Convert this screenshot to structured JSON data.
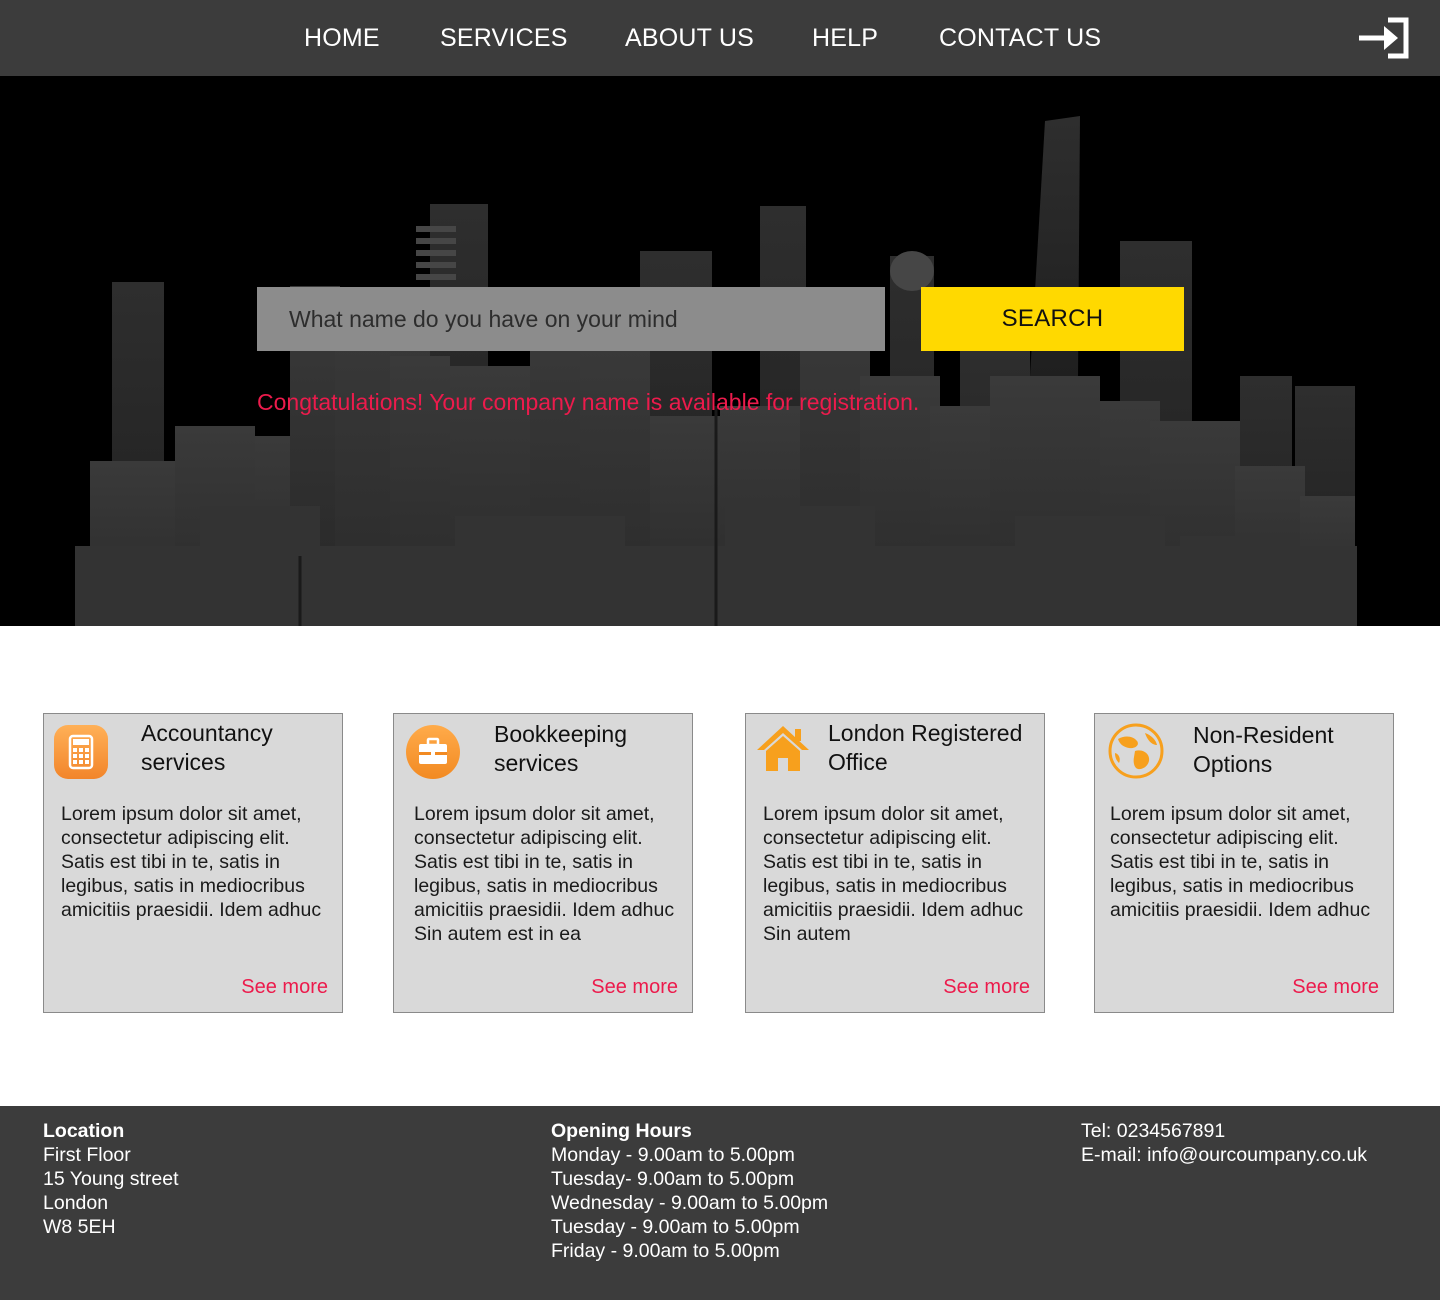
{
  "nav": {
    "items": [
      {
        "label": "HOME"
      },
      {
        "label": "SERVICES"
      },
      {
        "label": "ABOUT US"
      },
      {
        "label": "HELP"
      },
      {
        "label": "CONTACT US"
      }
    ],
    "login_icon": "sign-in-arrow-icon"
  },
  "hero": {
    "search_placeholder": "What name do you have on your mind",
    "search_button": "SEARCH",
    "message": "Congtatulations! Your company name is available for registration."
  },
  "services": [
    {
      "icon": "calculator-icon",
      "title_line1": "Accountancy",
      "title_line2": "services",
      "body": "Lorem ipsum dolor sit amet, consectetur adipiscing elit. Satis est tibi in te, satis in legibus, satis in mediocribus amicitiis praesidii. Idem adhuc",
      "link": "See more"
    },
    {
      "icon": "briefcase-icon",
      "title_line1": "Bookkeeping",
      "title_line2": "services",
      "body": "Lorem ipsum dolor sit amet, consectetur adipiscing elit. Satis est tibi in te, satis in legibus, satis in mediocribus amicitiis praesidii. Idem adhuc Sin autem est in ea",
      "link": "See more"
    },
    {
      "icon": "house-icon",
      "title_line1": "London Registered",
      "title_line2": "Office",
      "body": "Lorem ipsum dolor sit amet, consectetur adipiscing elit. Satis est tibi in te, satis in legibus, satis in mediocribus amicitiis praesidii. Idem adhuc Sin autem",
      "link": "See more"
    },
    {
      "icon": "globe-icon",
      "title_line1": "Non-Resident",
      "title_line2": "Options",
      "body": "Lorem ipsum dolor sit amet, consectetur adipiscing elit. Satis est tibi in te, satis in legibus, satis in mediocribus amicitiis praesidii. Idem adhuc",
      "link": "See more"
    }
  ],
  "footer": {
    "location": {
      "heading": "Location",
      "lines": [
        "First Floor",
        "15 Young street",
        "London",
        "W8 5EH"
      ]
    },
    "hours": {
      "heading": "Opening Hours",
      "lines": [
        "Monday - 9.00am to 5.00pm",
        "Tuesday- 9.00am to 5.00pm",
        "Wednesday - 9.00am to 5.00pm",
        "Tuesday - 9.00am to 5.00pm",
        "Friday - 9.00am to 5.00pm"
      ]
    },
    "contact": {
      "tel": "Tel: 0234567891",
      "email": "E-mail: info@ourcoumpany.co.uk"
    }
  },
  "colors": {
    "nav_bg": "#3c3c3c",
    "search_button": "#ffd900",
    "accent_red": "#ec1b4c",
    "icon_orange": "#f7a01d",
    "card_bg": "#d9d9d9"
  }
}
